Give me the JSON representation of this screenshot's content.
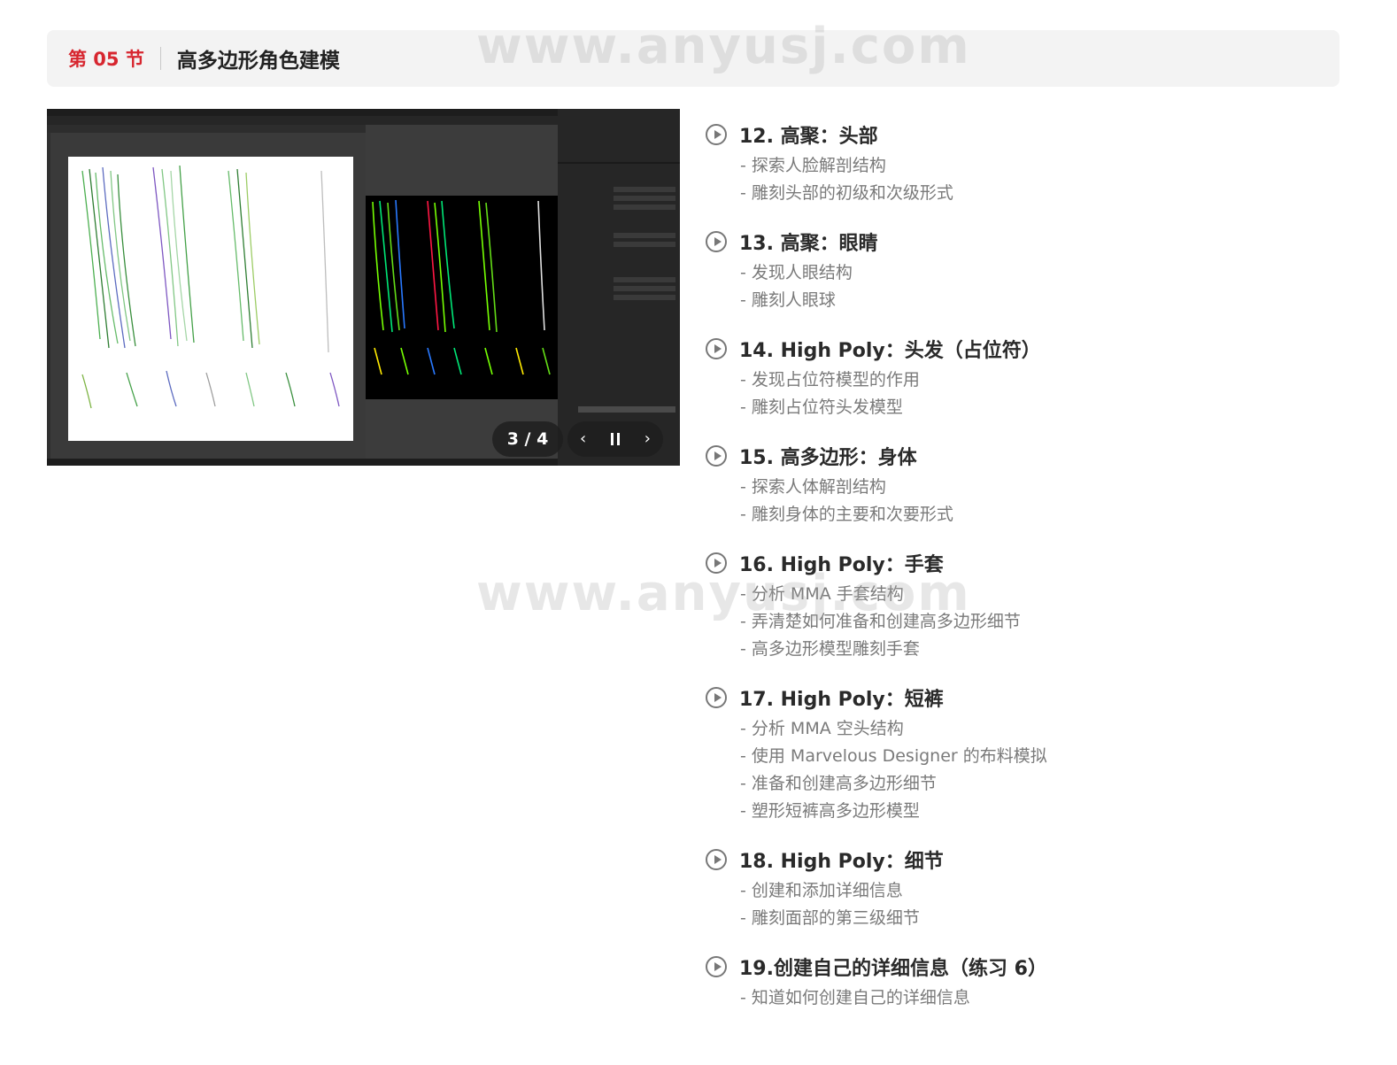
{
  "section": {
    "number": "第 05 节",
    "title": "高多边形角色建模"
  },
  "viewer": {
    "counter": "3 / 4",
    "prev_icon": "chevron-left-icon",
    "next_icon": "chevron-right-icon"
  },
  "lessons": [
    {
      "title": "12. 高聚：头部",
      "items": [
        "- 探索人脸解剖结构",
        "- 雕刻头部的初级和次级形式"
      ]
    },
    {
      "title": "13. 高聚：眼睛",
      "items": [
        "- 发现人眼结构",
        "- 雕刻人眼球"
      ]
    },
    {
      "title": "14. High Poly：头发（占位符）",
      "items": [
        "- 发现占位符模型的作用",
        "- 雕刻占位符头发模型"
      ]
    },
    {
      "title": "15. 高多边形：身体",
      "items": [
        "- 探索人体解剖结构",
        "- 雕刻身体的主要和次要形式"
      ]
    },
    {
      "title": "16. High Poly：手套",
      "items": [
        "- 分析 MMA 手套结构",
        "- 弄清楚如何准备和创建高多边形细节",
        "- 高多边形模型雕刻手套"
      ]
    },
    {
      "title": "17. High Poly：短裤",
      "items": [
        "- 分析 MMA 空头结构",
        "- 使用 Marvelous Designer 的布料模拟",
        "- 准备和创建高多边形细节",
        "- 塑形短裤高多边形模型"
      ]
    },
    {
      "title": "18. High Poly：细节",
      "items": [
        "- 创建和添加详细信息",
        "- 雕刻面部的第三级细节"
      ]
    },
    {
      "title": "19.创建自己的详细信息（练习 6）",
      "items": [
        "- 知道如何创建自己的详细信息"
      ]
    }
  ],
  "watermark": "www.anyusj.com",
  "colors": {
    "accent": "#d7262f"
  }
}
